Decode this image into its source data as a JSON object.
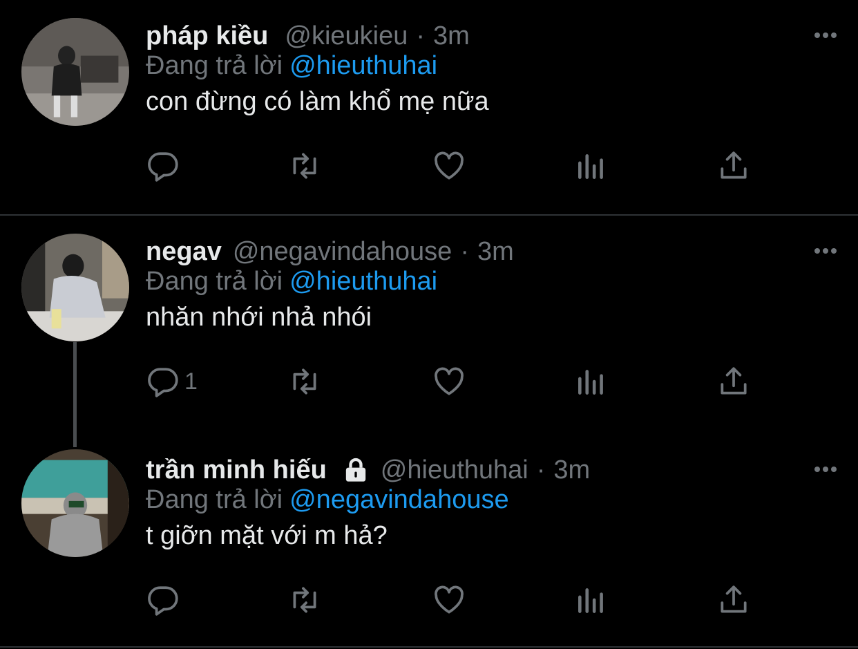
{
  "colors": {
    "background": "#000000",
    "text": "#e7e9ea",
    "muted": "#71767b",
    "accent": "#1d9bf0",
    "divider": "#2f3336"
  },
  "tweets": [
    {
      "name": "pháp kiều",
      "handle": "@kieukieu",
      "dot": "·",
      "time": "3m",
      "replying_label": "Đang trả lời",
      "replying_to": "@hieuthuhai",
      "text": "con đừng có làm khổ mẹ nữa",
      "reply_count": "",
      "locked": false
    },
    {
      "name": "negav",
      "handle": "@negavindahouse",
      "dot": "·",
      "time": "3m",
      "replying_label": "Đang trả lời",
      "replying_to": "@hieuthuhai",
      "text": "nhăn nhới nhả nhói",
      "reply_count": "1",
      "locked": false
    },
    {
      "name": "trần minh hiếu",
      "handle": "@hieuthuhai",
      "dot": "·",
      "time": "3m",
      "replying_label": "Đang trả lời",
      "replying_to": "@negavindahouse",
      "text": "t giỡn mặt với m hả?",
      "reply_count": "",
      "locked": true
    }
  ],
  "icons": [
    "reply-icon",
    "retweet-icon",
    "like-icon",
    "analytics-icon",
    "share-icon",
    "more-icon",
    "lock-icon"
  ]
}
